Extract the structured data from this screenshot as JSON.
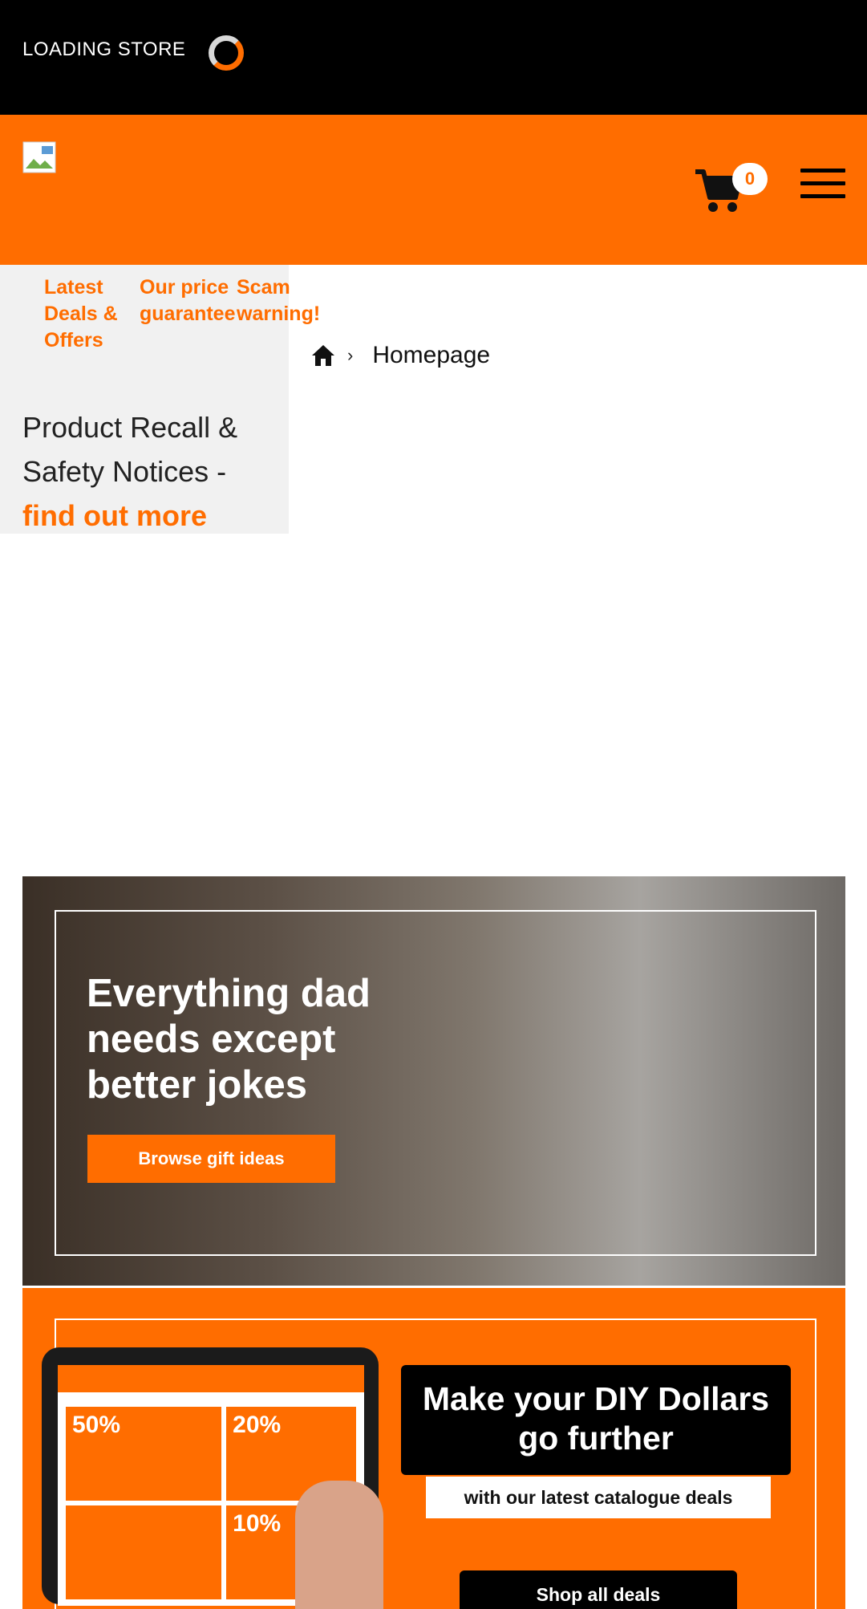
{
  "topbar": {
    "loading_text": "LOADING STORE"
  },
  "header": {
    "cart_count": "0",
    "logo_alt": "broken-image"
  },
  "nav": {
    "links": [
      {
        "label": "Latest Deals & Offers"
      },
      {
        "label": "Our price guarantee"
      },
      {
        "label": "Scam warning!"
      }
    ]
  },
  "recall": {
    "text": "Product Recall & Safety Notices - ",
    "link": "find out more"
  },
  "breadcrumb": {
    "separator": "›",
    "label": "Homepage"
  },
  "banner1": {
    "title": "Everything dad needs except better jokes",
    "button": "Browse gift ideas"
  },
  "banner2": {
    "headline": "Make your DIY Dollars go further",
    "subline": "with our latest catalogue deals",
    "button": "Shop all deals",
    "tablet_tiles": [
      "50%",
      "20%",
      "",
      "10%"
    ]
  },
  "colors": {
    "brand": "#ff6d00",
    "topbar": "#000000",
    "panel": "#f1f1f1"
  },
  "icons": [
    "spinner-icon",
    "cart-icon",
    "hamburger-icon",
    "home-icon"
  ]
}
